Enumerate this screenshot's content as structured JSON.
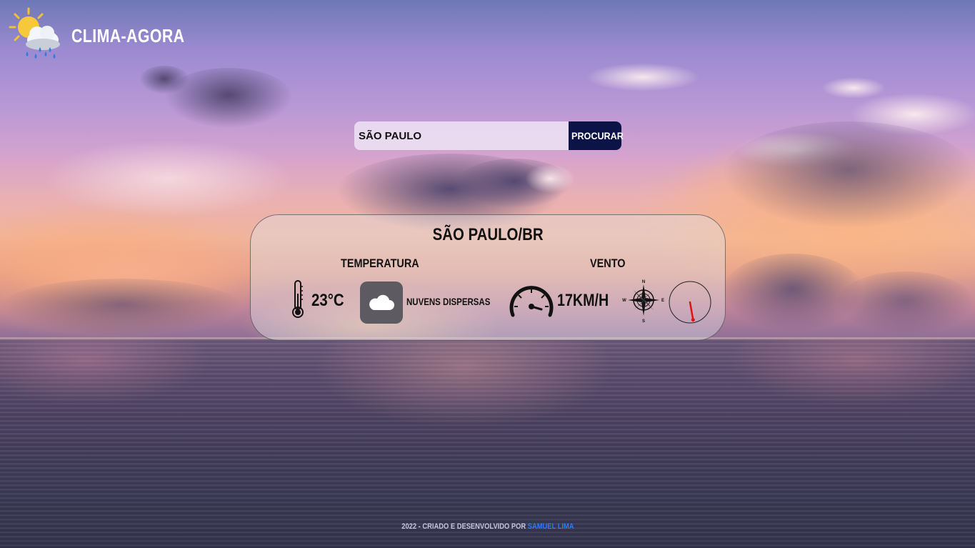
{
  "brand": {
    "title": "CLIMA-AGORA",
    "icon": "sun-cloud-rain-icon"
  },
  "search": {
    "value": "SÃO PAULO",
    "button_label": "PROCURAR"
  },
  "weather": {
    "city": "SÃO PAULO/BR",
    "temperature_label": "TEMPERATURA",
    "temperature": "23°C",
    "description": "NUVENS DISPERSAS",
    "wind_label": "VENTO",
    "wind_speed": "17KM/H",
    "compass": {
      "n": "N",
      "s": "S",
      "e": "E",
      "w": "W"
    },
    "wind_direction_deg": 170
  },
  "footer": {
    "text": "2022 - CRIADO E DESENVOLVIDO POR",
    "author": "SAMUEL LIMA"
  },
  "colors": {
    "button": "#0c1447",
    "link": "#2a7bff",
    "needle": "#e0140f"
  }
}
